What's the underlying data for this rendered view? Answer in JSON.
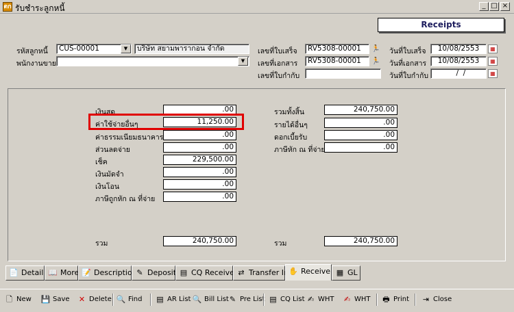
{
  "window": {
    "title": "รับชำระลูกหนี้",
    "app_icon": "ตก"
  },
  "header_box": "Receipts",
  "form": {
    "customer_code_label": "รหัสลูกหนี้",
    "customer_code": "CUS-00001",
    "customer_name": "บริษัท สยามพารากอน จำกัด",
    "salesperson_label": "พนักงานขาย",
    "salesperson": "",
    "receipt_no_label": "เลขที่ใบเสร็จ",
    "receipt_no": "RV5308-00001",
    "doc_no_label": "เลขที่เอกสาร",
    "doc_no": "RV5308-00001",
    "tax_inv_no_label": "เลขที่ใบกำกับ",
    "tax_inv_no": "",
    "receipt_date_label": "วันที่ใบเสร็จ",
    "receipt_date": "10/08/2553",
    "doc_date_label": "วันที่เอกสาร",
    "doc_date": "10/08/2553",
    "tax_inv_date_label": "วันที่ใบกำกับ",
    "tax_inv_date": "  /  /"
  },
  "left": {
    "cash_label": "เงินสด",
    "cash": ".00",
    "other_exp_label": "ค่าใช้จ่ายอื่นๆ",
    "other_exp": "11,250.00",
    "bank_fee_label": "ค่าธรรมเนียมธนาคาร",
    "bank_fee": ".00",
    "discount_label": "ส่วนลดจ่าย",
    "discount": ".00",
    "cheque_label": "เช็ค",
    "cheque": "229,500.00",
    "deposit_label": "เงินมัดจำ",
    "deposit": ".00",
    "transfer_label": "เงินโอน",
    "transfer": ".00",
    "wht_label": "ภาษีถูกหัก ณ ที่จ่าย",
    "wht": ".00",
    "total_label": "รวม",
    "total": "240,750.00"
  },
  "right": {
    "grand_label": "รวมทั้งสิ้น",
    "grand": "240,750.00",
    "other_inc_label": "รายได้อื่นๆ",
    "other_inc": ".00",
    "interest_label": "ดอกเบี้ยรับ",
    "interest": ".00",
    "wht_label": "ภาษีหัก ณ ที่จ่าย",
    "wht": ".00",
    "total_label": "รวม",
    "total": "240,750.00"
  },
  "tabs": [
    "Detail",
    "More",
    "Description",
    "Deposit",
    "CQ Receive",
    "Transfer In",
    "Receive",
    "GL"
  ],
  "toolbar": {
    "new": "New",
    "save": "Save",
    "delete": "Delete",
    "find": "Find",
    "ar_list": "AR List",
    "bill_list": "Bill List",
    "pre_list": "Pre List",
    "cq_list": "CQ List",
    "wht1": "WHT",
    "wht2": "WHT",
    "print": "Print",
    "close": "Close"
  }
}
